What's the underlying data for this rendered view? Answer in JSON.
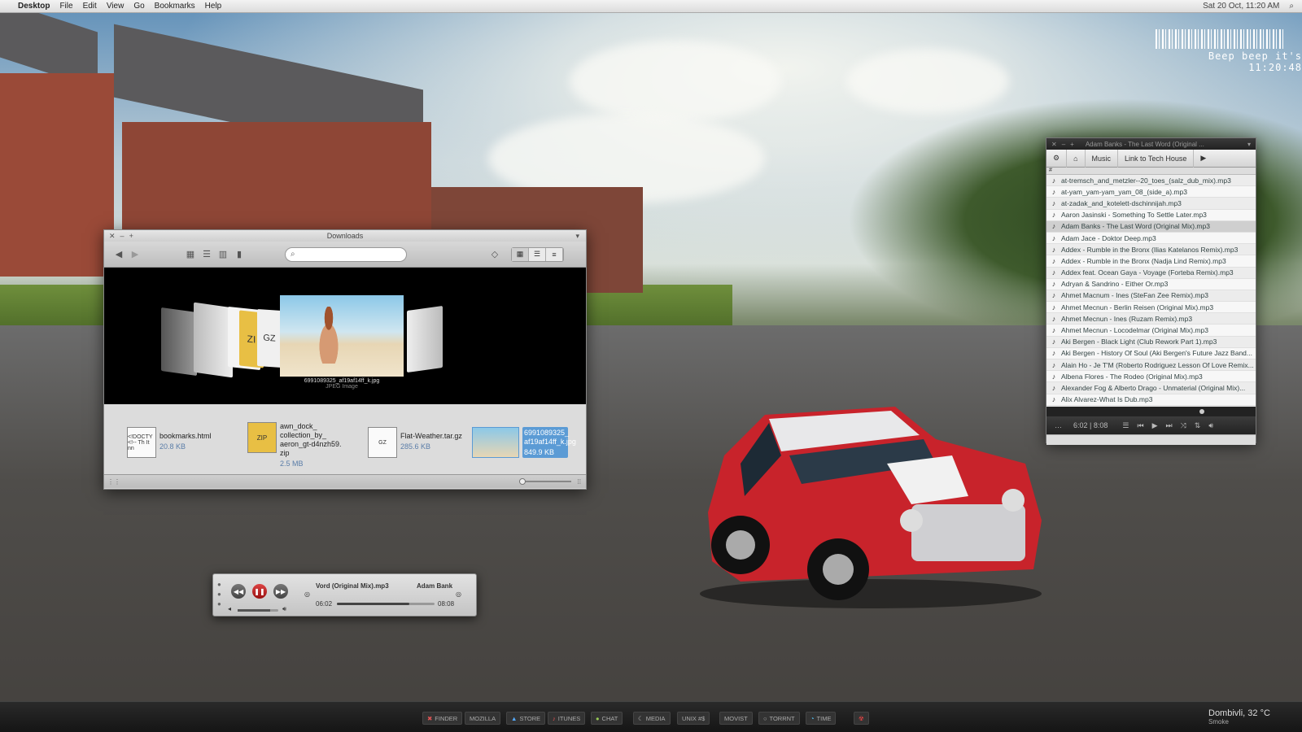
{
  "menubar": {
    "app": "Desktop",
    "items": [
      "File",
      "Edit",
      "View",
      "Go",
      "Bookmarks",
      "Help"
    ],
    "datetime": "Sat 20 Oct, 11:20 AM"
  },
  "clock": {
    "text": "Beep beep it's 11:20:48"
  },
  "finder": {
    "title": "Downloads",
    "cover_caption": "6991089325_af19af14ff_k.jpg",
    "cover_sub": "JPEG Image",
    "cover_icon_gz": "GZ",
    "cover_icon_zip": "ZI",
    "files": [
      {
        "name": "bookmarks.html",
        "size": "20.8 KB",
        "icon": "<!DOCTY <!-- Th It nn"
      },
      {
        "name": "awn_dock_ collection_by_ aeron_gt-d4nzh59. zip",
        "size": "2.5 MB",
        "icon": "ZIP"
      },
      {
        "name": "Flat-Weather.tar.gz",
        "size": "285.6 KB",
        "icon": "GZ"
      },
      {
        "name": "6991089325_ af19af14ff_k.jpg",
        "size": "849.9 KB",
        "icon": ""
      }
    ]
  },
  "music": {
    "title": "Adam Banks - The Last Word (Original ...",
    "path": [
      "Music",
      "Link to Tech House"
    ],
    "header": "#",
    "time": "6:02 | 8:08",
    "tracks": [
      "at-tremsch_and_metzler--20_toes_(salz_dub_mix).mp3",
      "at-yam_yam-yam_yam_08_(side_a).mp3",
      "at-zadak_and_kotelett-dschinnijah.mp3",
      "Aaron Jasinski - Something To Settle Later.mp3",
      "Adam Banks - The Last Word (Original Mix).mp3",
      "Adam Jace - Doktor Deep.mp3",
      "Addex - Rumble in the Bronx (Ilias Katelanos Remix).mp3",
      "Addex - Rumble in the Bronx (Nadja Lind Remix).mp3",
      "Addex feat. Ocean Gaya - Voyage (Forteba Remix).mp3",
      "Adryan & Sandrino - Either Or.mp3",
      "Ahmet Macnum - Ines (SteFan Zee Remix).mp3",
      "Ahmet Mecnun - Berlin Reisen (Original Mix).mp3",
      "Ahmet Mecnun - Ines (Ruzam Remix).mp3",
      "Ahmet Mecnun - Locodelmar (Original Mix).mp3",
      "Aki Bergen - Black Light (Club Rework Part 1).mp3",
      "Aki Bergen - History Of Soul (Aki Bergen's Future Jazz Band...",
      "Alain Ho - Je T'M (Roberto Rodriguez Lesson Of Love Remix...",
      "Albena Flores - The Rodeo (Original Mix).mp3",
      "Alexander Fog & Alberto Drago - Unmaterial (Original Mix)...",
      "Alix Alvarez-What Is Dub.mp3"
    ],
    "current_index": 4
  },
  "mini": {
    "track": "Vord (Original Mix).mp3",
    "artist": "Adam Bank",
    "elapsed": "06:02",
    "total": "08:08",
    "progress": 0.74,
    "volume": 0.8
  },
  "dock": {
    "items": [
      "FINDER",
      "MOZILLA",
      "STORE",
      "ITUNES",
      "CHAT",
      "MEDIA",
      "UNIX #$",
      "MOVIST",
      "TORRNT",
      "TIME"
    ]
  },
  "weather": {
    "city": "Dombivli, 32 °C",
    "cond": "Smoke"
  }
}
